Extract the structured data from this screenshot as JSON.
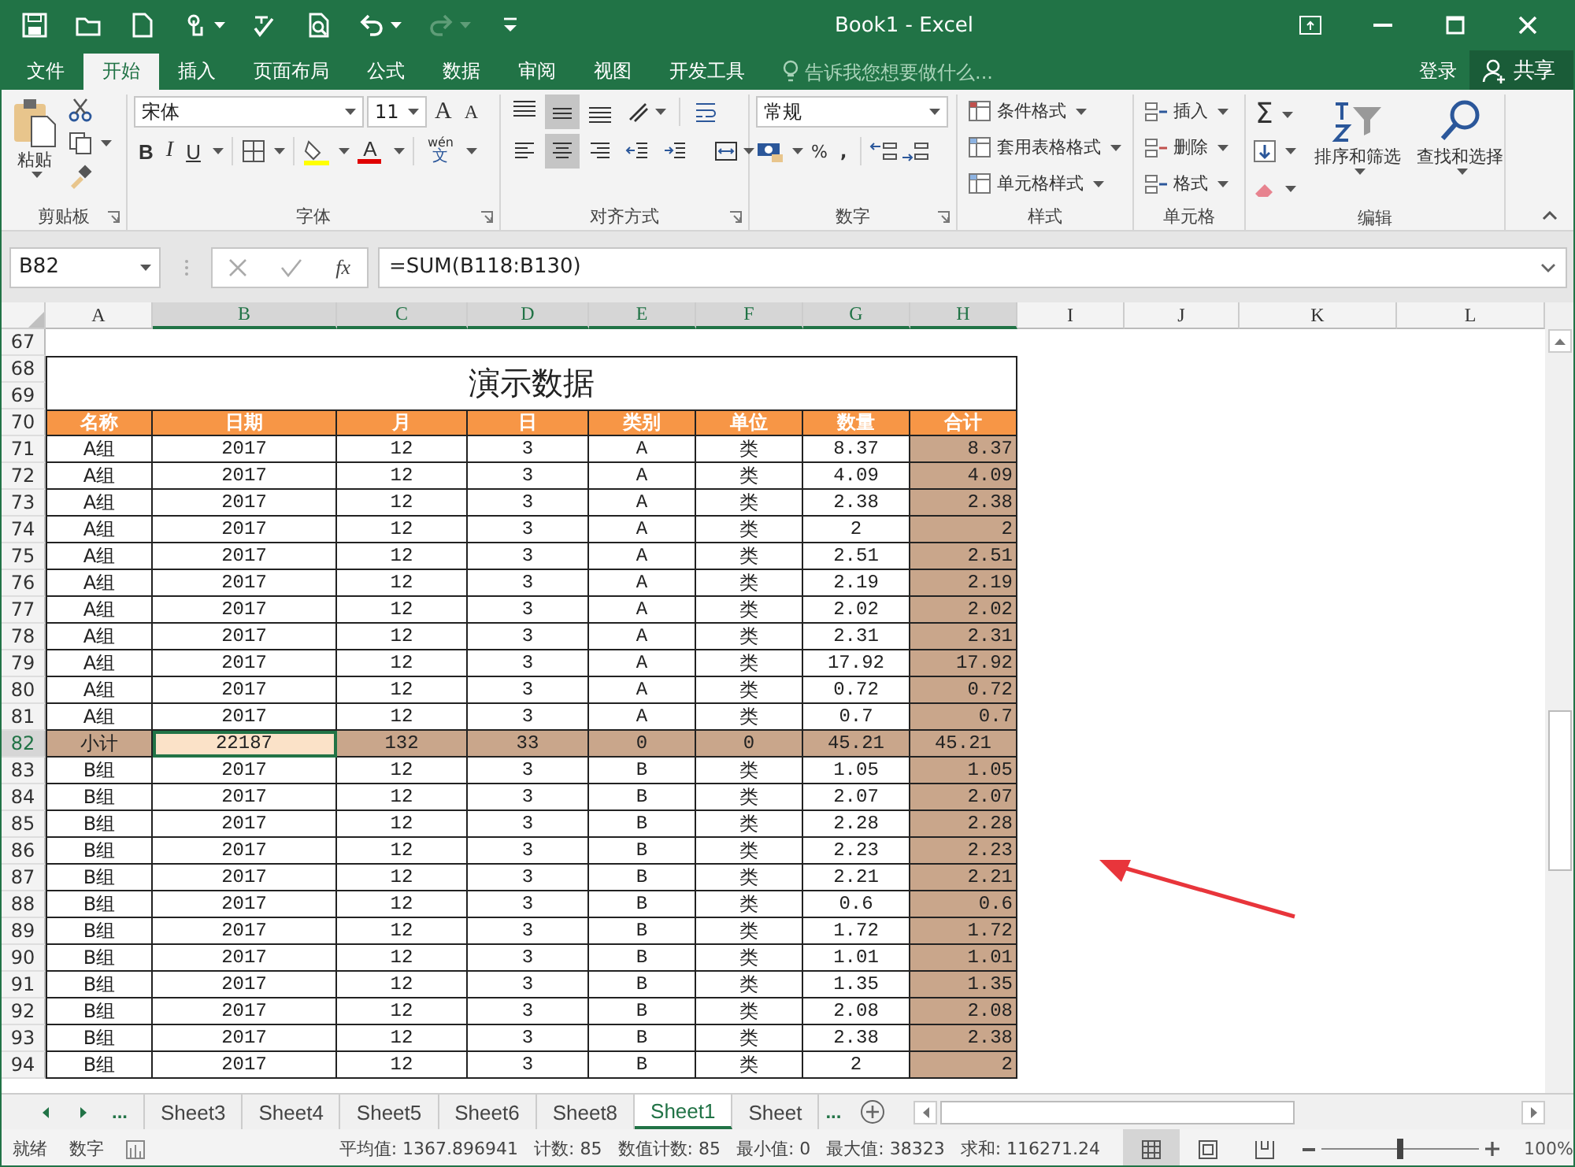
{
  "title_bar": {
    "title": "Book1 - Excel"
  },
  "quick_access": [
    {
      "kind": "save",
      "disabled": false
    },
    {
      "kind": "open",
      "disabled": false
    },
    {
      "kind": "new",
      "disabled": false
    },
    {
      "kind": "touch",
      "disabled": false
    },
    {
      "kind": "spelling",
      "disabled": false
    },
    {
      "kind": "preview",
      "disabled": false
    },
    {
      "kind": "undo",
      "disabled": false
    },
    {
      "kind": "redo",
      "disabled": true
    },
    {
      "kind": "customize",
      "disabled": false
    }
  ],
  "ribbon_tabs": [
    {
      "label": "文件",
      "selected": false
    },
    {
      "label": "开始",
      "selected": true
    },
    {
      "label": "插入",
      "selected": false
    },
    {
      "label": "页面布局",
      "selected": false
    },
    {
      "label": "公式",
      "selected": false
    },
    {
      "label": "数据",
      "selected": false
    },
    {
      "label": "审阅",
      "selected": false
    },
    {
      "label": "视图",
      "selected": false
    },
    {
      "label": "开发工具",
      "selected": false
    }
  ],
  "tell_me": {
    "placeholder": "告诉我您想要做什么..."
  },
  "sign_in": "登录",
  "share": "共享",
  "ribbon": {
    "clipboard": {
      "label": "剪贴板",
      "paste": "粘贴"
    },
    "font": {
      "label": "字体",
      "font_name": "宋体",
      "font_size": "11",
      "grow": "A",
      "shrink": "A",
      "bold": "B",
      "italic": "I",
      "underline": "U",
      "font_color": "A",
      "phonetic_top": "wén",
      "phonetic_bottom": "文"
    },
    "alignment": {
      "label": "对齐方式",
      "buttons": [
        {
          "kind": "top",
          "selected": false
        },
        {
          "kind": "middle",
          "selected": true
        },
        {
          "kind": "bottom",
          "selected": false
        },
        {
          "kind": "orientation",
          "selected": false
        },
        {
          "kind": "wrap",
          "selected": false
        },
        {
          "kind": "left",
          "selected": false
        },
        {
          "kind": "center",
          "selected": true
        },
        {
          "kind": "right",
          "selected": false
        },
        {
          "kind": "outdent",
          "selected": false
        },
        {
          "kind": "indent",
          "selected": false
        },
        {
          "kind": "merge",
          "selected": false
        }
      ]
    },
    "number": {
      "label": "数字",
      "format": "常规",
      "percent": "%",
      "comma": ","
    },
    "styles": {
      "label": "样式",
      "items": [
        "条件格式",
        "套用表格格式",
        "单元格样式"
      ]
    },
    "cells": {
      "label": "单元格",
      "items": [
        "插入",
        "删除",
        "格式"
      ]
    },
    "editing": {
      "label": "编辑",
      "sum": "Σ",
      "items": [
        "排序和筛选",
        "查找和选择"
      ]
    }
  },
  "formula_bar": {
    "name_box": "B82",
    "function_label": "fx",
    "formula": "=SUM(B118:B130)"
  },
  "columns": [
    {
      "label": "A",
      "selected": false
    },
    {
      "label": "B",
      "selected": true
    },
    {
      "label": "C",
      "selected": true
    },
    {
      "label": "D",
      "selected": true
    },
    {
      "label": "E",
      "selected": true
    },
    {
      "label": "F",
      "selected": true
    },
    {
      "label": "G",
      "selected": true
    },
    {
      "label": "H",
      "selected": true
    },
    {
      "label": "I",
      "selected": false
    },
    {
      "label": "J",
      "selected": false
    },
    {
      "label": "K",
      "selected": false
    },
    {
      "label": "L",
      "selected": false
    }
  ],
  "blank_row": "67",
  "title_rows": {
    "headers": [
      "68",
      "69"
    ],
    "text": "演示数据"
  },
  "header_row": {
    "header": "70",
    "cells": [
      "名称",
      "日期",
      "月",
      "日",
      "类别",
      "单位",
      "数量",
      "合计"
    ]
  },
  "rows": [
    {
      "header": "71",
      "kind": "data",
      "selected": false,
      "cells": [
        "A组",
        "2017",
        "12",
        "3",
        "A",
        "类",
        "8.37",
        "8.37"
      ]
    },
    {
      "header": "72",
      "kind": "data",
      "selected": false,
      "cells": [
        "A组",
        "2017",
        "12",
        "3",
        "A",
        "类",
        "4.09",
        "4.09"
      ]
    },
    {
      "header": "73",
      "kind": "data",
      "selected": false,
      "cells": [
        "A组",
        "2017",
        "12",
        "3",
        "A",
        "类",
        "2.38",
        "2.38"
      ]
    },
    {
      "header": "74",
      "kind": "data",
      "selected": false,
      "cells": [
        "A组",
        "2017",
        "12",
        "3",
        "A",
        "类",
        "2",
        "2"
      ]
    },
    {
      "header": "75",
      "kind": "data",
      "selected": false,
      "cells": [
        "A组",
        "2017",
        "12",
        "3",
        "A",
        "类",
        "2.51",
        "2.51"
      ]
    },
    {
      "header": "76",
      "kind": "data",
      "selected": false,
      "cells": [
        "A组",
        "2017",
        "12",
        "3",
        "A",
        "类",
        "2.19",
        "2.19"
      ]
    },
    {
      "header": "77",
      "kind": "data",
      "selected": false,
      "cells": [
        "A组",
        "2017",
        "12",
        "3",
        "A",
        "类",
        "2.02",
        "2.02"
      ]
    },
    {
      "header": "78",
      "kind": "data",
      "selected": false,
      "cells": [
        "A组",
        "2017",
        "12",
        "3",
        "A",
        "类",
        "2.31",
        "2.31"
      ]
    },
    {
      "header": "79",
      "kind": "data",
      "selected": false,
      "cells": [
        "A组",
        "2017",
        "12",
        "3",
        "A",
        "类",
        "17.92",
        "17.92"
      ]
    },
    {
      "header": "80",
      "kind": "data",
      "selected": false,
      "cells": [
        "A组",
        "2017",
        "12",
        "3",
        "A",
        "类",
        "0.72",
        "0.72"
      ]
    },
    {
      "header": "81",
      "kind": "data",
      "selected": false,
      "cells": [
        "A组",
        "2017",
        "12",
        "3",
        "A",
        "类",
        "0.7",
        "0.7"
      ]
    },
    {
      "header": "82",
      "kind": "subtotal",
      "selected": true,
      "cells": [
        "小计",
        "22187",
        "132",
        "33",
        "0",
        "0",
        "45.21",
        "45.21"
      ],
      "selected_cells": [
        false,
        true,
        false,
        false,
        false,
        false,
        false,
        false
      ]
    },
    {
      "header": "83",
      "kind": "data",
      "selected": false,
      "cells": [
        "B组",
        "2017",
        "12",
        "3",
        "B",
        "类",
        "1.05",
        "1.05"
      ]
    },
    {
      "header": "84",
      "kind": "data",
      "selected": false,
      "cells": [
        "B组",
        "2017",
        "12",
        "3",
        "B",
        "类",
        "2.07",
        "2.07"
      ]
    },
    {
      "header": "85",
      "kind": "data",
      "selected": false,
      "cells": [
        "B组",
        "2017",
        "12",
        "3",
        "B",
        "类",
        "2.28",
        "2.28"
      ]
    },
    {
      "header": "86",
      "kind": "data",
      "selected": false,
      "cells": [
        "B组",
        "2017",
        "12",
        "3",
        "B",
        "类",
        "2.23",
        "2.23"
      ]
    },
    {
      "header": "87",
      "kind": "data",
      "selected": false,
      "cells": [
        "B组",
        "2017",
        "12",
        "3",
        "B",
        "类",
        "2.21",
        "2.21"
      ]
    },
    {
      "header": "88",
      "kind": "data",
      "selected": false,
      "cells": [
        "B组",
        "2017",
        "12",
        "3",
        "B",
        "类",
        "0.6",
        "0.6"
      ]
    },
    {
      "header": "89",
      "kind": "data",
      "selected": false,
      "cells": [
        "B组",
        "2017",
        "12",
        "3",
        "B",
        "类",
        "1.72",
        "1.72"
      ]
    },
    {
      "header": "90",
      "kind": "data",
      "selected": false,
      "cells": [
        "B组",
        "2017",
        "12",
        "3",
        "B",
        "类",
        "1.01",
        "1.01"
      ]
    },
    {
      "header": "91",
      "kind": "data",
      "selected": false,
      "cells": [
        "B组",
        "2017",
        "12",
        "3",
        "B",
        "类",
        "1.35",
        "1.35"
      ]
    },
    {
      "header": "92",
      "kind": "data",
      "selected": false,
      "cells": [
        "B组",
        "2017",
        "12",
        "3",
        "B",
        "类",
        "2.08",
        "2.08"
      ]
    },
    {
      "header": "93",
      "kind": "data",
      "selected": false,
      "cells": [
        "B组",
        "2017",
        "12",
        "3",
        "B",
        "类",
        "2.38",
        "2.38"
      ]
    },
    {
      "header": "94",
      "kind": "data",
      "selected": false,
      "cells": [
        "B组",
        "2017",
        "12",
        "3",
        "B",
        "类",
        "2",
        "2"
      ]
    }
  ],
  "sheet_tabs": {
    "more_before": "...",
    "tabs": [
      {
        "label": "Sheet3",
        "selected": false
      },
      {
        "label": "Sheet4",
        "selected": false
      },
      {
        "label": "Sheet5",
        "selected": false
      },
      {
        "label": "Sheet6",
        "selected": false
      },
      {
        "label": "Sheet8",
        "selected": false
      },
      {
        "label": "Sheet1",
        "selected": true
      },
      {
        "label": "Sheet",
        "selected": false
      }
    ],
    "more_after": "..."
  },
  "status_bar": {
    "mode": "就绪",
    "num_lock": "数字",
    "stats": [
      "平均值: 1367.896941",
      "计数: 85",
      "数值计数: 85",
      "最小值: 0",
      "最大值: 38323",
      "求和: 116271.24"
    ],
    "views": [
      {
        "kind": "normal",
        "selected": true
      },
      {
        "kind": "page_layout",
        "selected": false
      },
      {
        "kind": "page_break",
        "selected": false
      }
    ],
    "zoom_slider": {
      "level": 0.5
    },
    "zoom": "100%"
  }
}
